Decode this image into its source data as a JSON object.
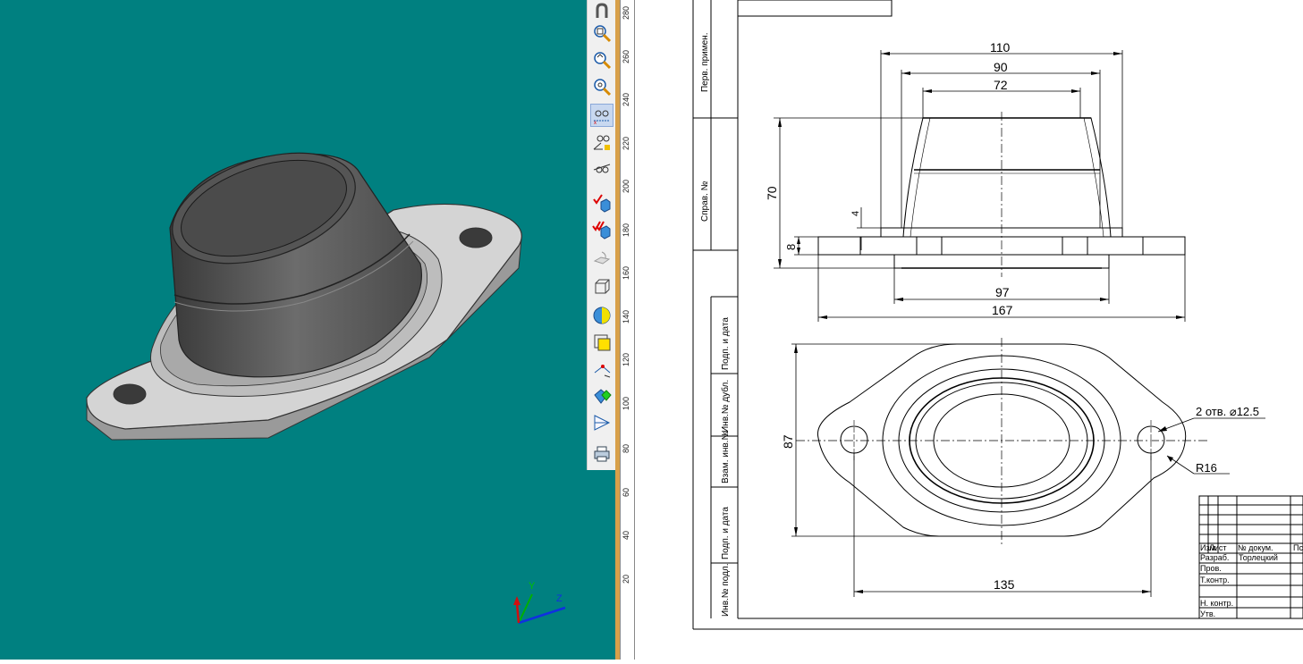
{
  "viewport": {
    "background": "#008080",
    "axes": {
      "y_label": "Y",
      "z_label": "Z"
    }
  },
  "toolbar": {
    "items": [
      {
        "name": "magnet-icon"
      },
      {
        "name": "zoom-window-icon"
      },
      {
        "name": "zoom-frame-icon"
      },
      {
        "name": "zoom-all-icon"
      },
      {
        "name": "glasses-snap-icon",
        "active": true
      },
      {
        "name": "glasses-angle-icon"
      },
      {
        "name": "glasses-line-icon"
      },
      {
        "name": "check-cube-icon"
      },
      {
        "name": "double-check-cube-icon"
      },
      {
        "name": "plane-rotate-icon"
      },
      {
        "name": "wire-cube-icon"
      },
      {
        "name": "sphere-section-icon"
      },
      {
        "name": "yellow-face-icon"
      },
      {
        "name": "point-axis-icon"
      },
      {
        "name": "green-diamond-icon"
      },
      {
        "name": "pyramid-icon"
      },
      {
        "name": "printer-icon"
      }
    ]
  },
  "ruler": {
    "labels": [
      "280",
      "260",
      "240",
      "220",
      "200",
      "180",
      "160",
      "140",
      "120",
      "100",
      "80",
      "60",
      "40",
      "20"
    ]
  },
  "drawing": {
    "side_labels": {
      "perv_primen": "Перв. примен.",
      "sprav": "Справ. №",
      "podp_data_1": "Подп. и дата",
      "inv_dubl": "Инв.№ дубл.",
      "vzam_inv": "Взам. инв.№",
      "podp_data_2": "Подп. и дата",
      "inv_podl": "Инв.№ подл."
    },
    "dimensions": {
      "d110": "110",
      "d90": "90",
      "d72": "72",
      "d70": "70",
      "d4": "4",
      "d8": "8",
      "d97": "97",
      "d167": "167",
      "d87": "87",
      "d135": "135",
      "holes": "2 отв. ⌀12.5",
      "r16": "R16"
    },
    "title_block": {
      "izm": "Изм.",
      "list": "Лист",
      "doc": "№ докум.",
      "podp": "Пс",
      "razrab": "Разраб.",
      "author": "Торлецкий",
      "prov": "Пров.",
      "tkontr": "Т.контр.",
      "nkontr": "Н. контр.",
      "utv": "Утв."
    }
  }
}
